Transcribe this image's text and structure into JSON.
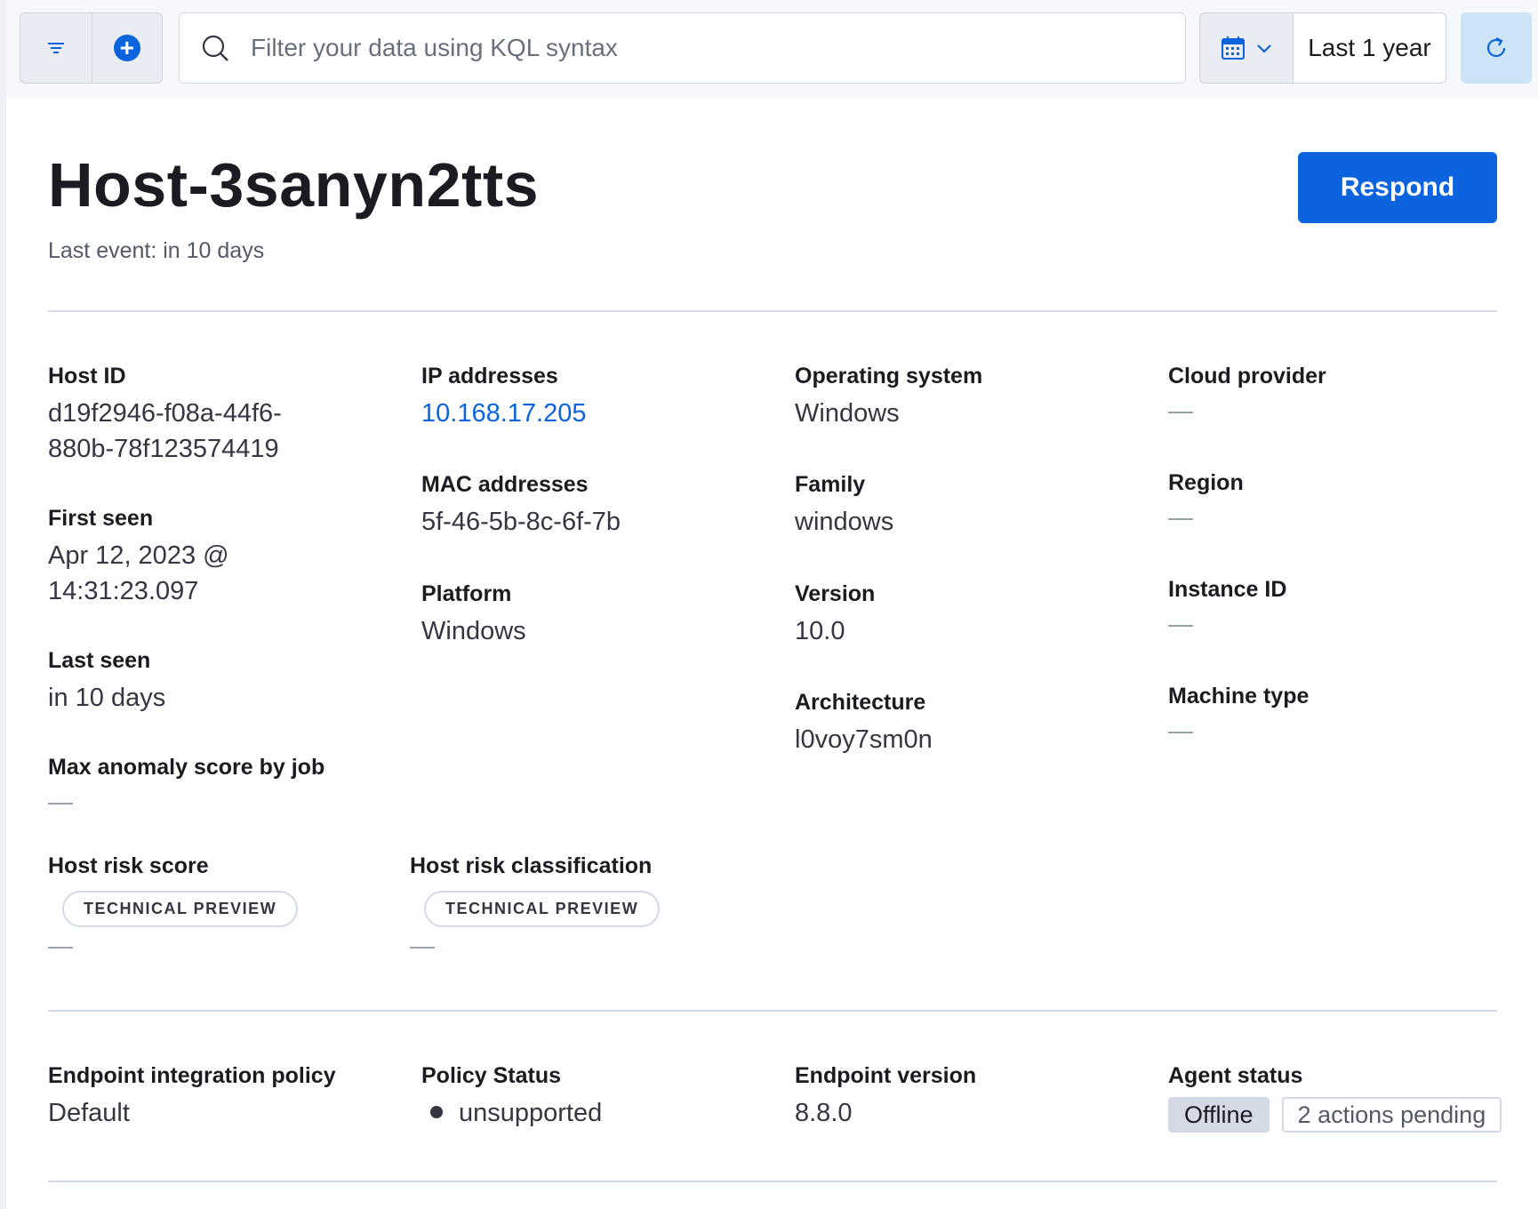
{
  "query_bar": {
    "search_placeholder": "Filter your data using KQL syntax",
    "search_value": "",
    "date_range_label": "Last 1 year"
  },
  "header": {
    "title": "Host-3sanyn2tts",
    "last_event": "Last event: in 10 days",
    "respond_label": "Respond"
  },
  "overview": {
    "host_id": {
      "label": "Host ID",
      "value_line1": "d19f2946-f08a-44f6-",
      "value_line2": "880b-78f123574419"
    },
    "first_seen": {
      "label": "First seen",
      "value_line1": "Apr 12, 2023 @",
      "value_line2": "14:31:23.097"
    },
    "last_seen": {
      "label": "Last seen",
      "value": "in 10 days"
    },
    "max_anomaly": {
      "label": "Max anomaly score by job",
      "value": "—"
    },
    "ip_addresses": {
      "label": "IP addresses",
      "value": "10.168.17.205"
    },
    "mac_addresses": {
      "label": "MAC addresses",
      "value": "5f-46-5b-8c-6f-7b"
    },
    "platform": {
      "label": "Platform",
      "value": "Windows"
    },
    "operating_system": {
      "label": "Operating system",
      "value": "Windows"
    },
    "family": {
      "label": "Family",
      "value": "windows"
    },
    "version": {
      "label": "Version",
      "value": "10.0"
    },
    "architecture": {
      "label": "Architecture",
      "value": "l0voy7sm0n"
    },
    "cloud_provider": {
      "label": "Cloud provider",
      "value": "—"
    },
    "region": {
      "label": "Region",
      "value": "—"
    },
    "instance_id": {
      "label": "Instance ID",
      "value": "—"
    },
    "machine_type": {
      "label": "Machine type",
      "value": "—"
    },
    "host_risk_score": {
      "label": "Host risk score",
      "badge": "TECHNICAL PREVIEW",
      "value": "—"
    },
    "host_risk_classification": {
      "label": "Host risk classification",
      "badge": "TECHNICAL PREVIEW",
      "value": "—"
    }
  },
  "endpoint": {
    "integration_policy": {
      "label": "Endpoint integration policy",
      "value": "Default"
    },
    "policy_status": {
      "label": "Policy Status",
      "value": "unsupported"
    },
    "endpoint_version": {
      "label": "Endpoint version",
      "value": "8.8.0"
    },
    "agent_status": {
      "label": "Agent status",
      "status": "Offline",
      "pending": "2 actions pending"
    }
  },
  "colors": {
    "primary": "#0b64dd",
    "link": "#0b64dd",
    "empty_dash": "#98a2b3",
    "divider": "#d3dae6"
  },
  "icons": [
    "filter-icon",
    "add-filter-icon",
    "search-icon",
    "calendar-icon",
    "chevron-down-icon",
    "refresh-icon"
  ]
}
